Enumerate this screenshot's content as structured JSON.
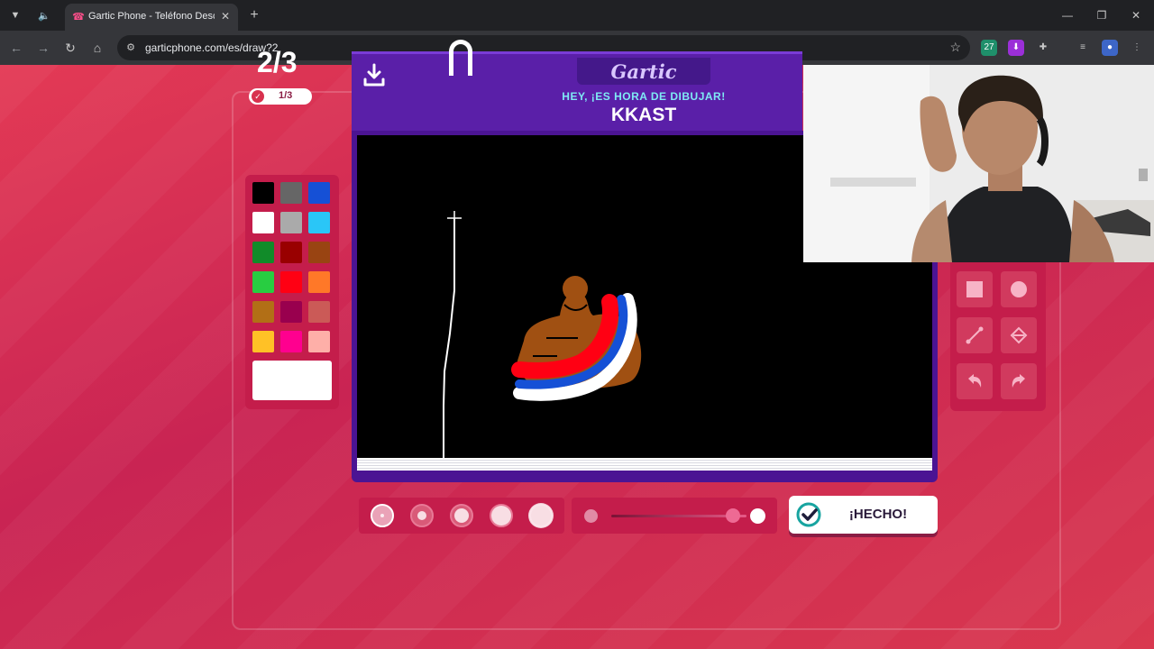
{
  "browser": {
    "tab_title": "Gartic Phone - Teléfono Descon",
    "url": "garticphone.com/es/draw?2"
  },
  "game": {
    "round_counter": "2/3",
    "done_count": "1/3",
    "logo": "Gartic",
    "prompt_intro": "HEY, ¡ES HORA DE DIBUJAR!",
    "prompt_word": "KKAST",
    "done_button": "¡HECHO!",
    "palette": [
      "#000000",
      "#666666",
      "#1550d6",
      "#ffffff",
      "#aaaaaa",
      "#2ac6f7",
      "#118b29",
      "#990000",
      "#994412",
      "#28cd41",
      "#ff0013",
      "#ff7828",
      "#b26f16",
      "#99004e",
      "#cb5a57",
      "#ffc126",
      "#ff008f",
      "#feafa8"
    ],
    "selected_color": "#ffffff",
    "brush_sizes": 5,
    "selected_brush_size": 1,
    "opacity_level": 0.9
  }
}
